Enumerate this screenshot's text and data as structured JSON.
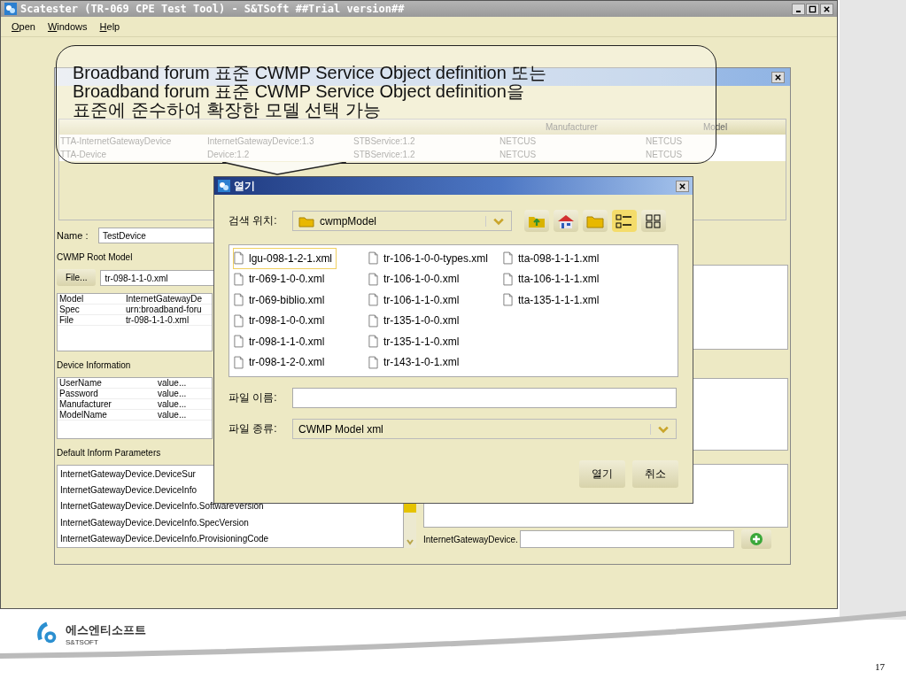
{
  "window": {
    "title": "Scatester (TR-069 CPE Test Tool) - S&TSoft ##Trial version##"
  },
  "menu": [
    {
      "label": "Open"
    },
    {
      "label": "Windows"
    },
    {
      "label": "Help"
    }
  ],
  "device_window": {
    "table": {
      "columns": [
        "Manufacturer",
        "Model"
      ],
      "rows": [
        [
          "TTA-InternetGatewayDevice",
          "InternetGatewayDevice:1.3",
          "STBService:1.2",
          "NETCUS",
          "NETCUS"
        ],
        [
          "TTA-Device",
          "Device:1.2",
          "STBService:1.2",
          "NETCUS",
          "NETCUS"
        ]
      ]
    },
    "name_label": "Name :",
    "name_value": "TestDevice",
    "root_model": {
      "title": "CWMP Root Model",
      "file_button": "File...",
      "file_value": "tr-098-1-1-0.xml",
      "properties": [
        [
          "Model",
          "InternetGatewayDe"
        ],
        [
          "Spec",
          "urn:broadband-foru"
        ],
        [
          "File",
          "tr-098-1-1-0.xml"
        ]
      ]
    },
    "device_info": {
      "title": "Device Information",
      "rows": [
        [
          "UserName",
          "value..."
        ],
        [
          "Password",
          "value..."
        ],
        [
          "Manufacturer",
          "value..."
        ],
        [
          "ModelName",
          "value..."
        ]
      ]
    },
    "inform": {
      "title": "Default Inform Parameters",
      "items": [
        "InternetGatewayDevice.DeviceSur",
        "InternetGatewayDevice.DeviceInfo",
        "InternetGatewayDevice.DeviceInfo.SoftwareVersion",
        "InternetGatewayDevice.DeviceInfo.SpecVersion",
        "InternetGatewayDevice.DeviceInfo.ProvisioningCode"
      ]
    },
    "path_label": "InternetGatewayDevice."
  },
  "callout": {
    "lines": [
      "Broadband forum 표준 CWMP Service Object definition 또는",
      "Broadband forum 표준 CWMP Service Object definition을",
      "표준에 준수하여 확장한 모델 선택 가능"
    ]
  },
  "dialog": {
    "title": "열기",
    "look_in_label": "검색 위치:",
    "look_in": "cwmpModel",
    "toolbar": [
      {
        "kind": "up",
        "selected": false
      },
      {
        "kind": "home",
        "selected": false
      },
      {
        "kind": "new-folder",
        "selected": false
      },
      {
        "kind": "details",
        "selected": true
      },
      {
        "kind": "list",
        "selected": false
      }
    ],
    "files": [
      {
        "name": "lgu-098-1-2-1.xml",
        "selected": true
      },
      {
        "name": "tr-069-1-0-0.xml",
        "selected": false
      },
      {
        "name": "tr-069-biblio.xml",
        "selected": false
      },
      {
        "name": "tr-098-1-0-0.xml",
        "selected": false
      },
      {
        "name": "tr-098-1-1-0.xml",
        "selected": false
      },
      {
        "name": "tr-098-1-2-0.xml",
        "selected": false
      },
      {
        "name": "tr-106-1-0-0-types.xml",
        "selected": false
      },
      {
        "name": "tr-106-1-0-0.xml",
        "selected": false
      },
      {
        "name": "tr-106-1-1-0.xml",
        "selected": false
      },
      {
        "name": "tr-135-1-0-0.xml",
        "selected": false
      },
      {
        "name": "tr-135-1-1-0.xml",
        "selected": false
      },
      {
        "name": "tr-143-1-0-1.xml",
        "selected": false
      },
      {
        "name": "tta-098-1-1-1.xml",
        "selected": false
      },
      {
        "name": "tta-106-1-1-1.xml",
        "selected": false
      },
      {
        "name": "tta-135-1-1-1.xml",
        "selected": false
      }
    ],
    "file_name_label": "파일 이름:",
    "file_type_label": "파일 종류:",
    "file_type": "CWMP Model xml",
    "buttons": [
      "열기",
      "취소"
    ]
  },
  "footer": {
    "logo_text": "에스엔티소프트",
    "logo_subtext": "S&TSOFT",
    "page": "17"
  }
}
